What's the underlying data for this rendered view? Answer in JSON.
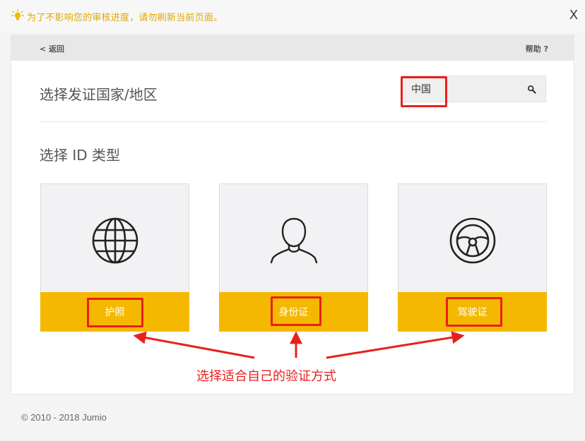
{
  "notice": {
    "message": "为了不影响您的审核进度，请勿刷新当前页面。",
    "close_label": "X"
  },
  "topbar": {
    "back_label": "< 返回",
    "help_label": "帮助 ?"
  },
  "country": {
    "title": "选择发证国家/地区",
    "value": "中国"
  },
  "id_type": {
    "title": "选择 ID 类型",
    "options": [
      {
        "label": "护照",
        "icon": "globe-icon"
      },
      {
        "label": "身份证",
        "icon": "person-icon"
      },
      {
        "label": "驾驶证",
        "icon": "steering-wheel-icon"
      }
    ]
  },
  "annotation": {
    "text": "选择适合自己的验证方式"
  },
  "footer": {
    "copyright": "© 2010 - 2018 Jumio"
  },
  "colors": {
    "accent": "#f5b800",
    "annotation": "#e8201c",
    "notice": "#e2a800"
  }
}
